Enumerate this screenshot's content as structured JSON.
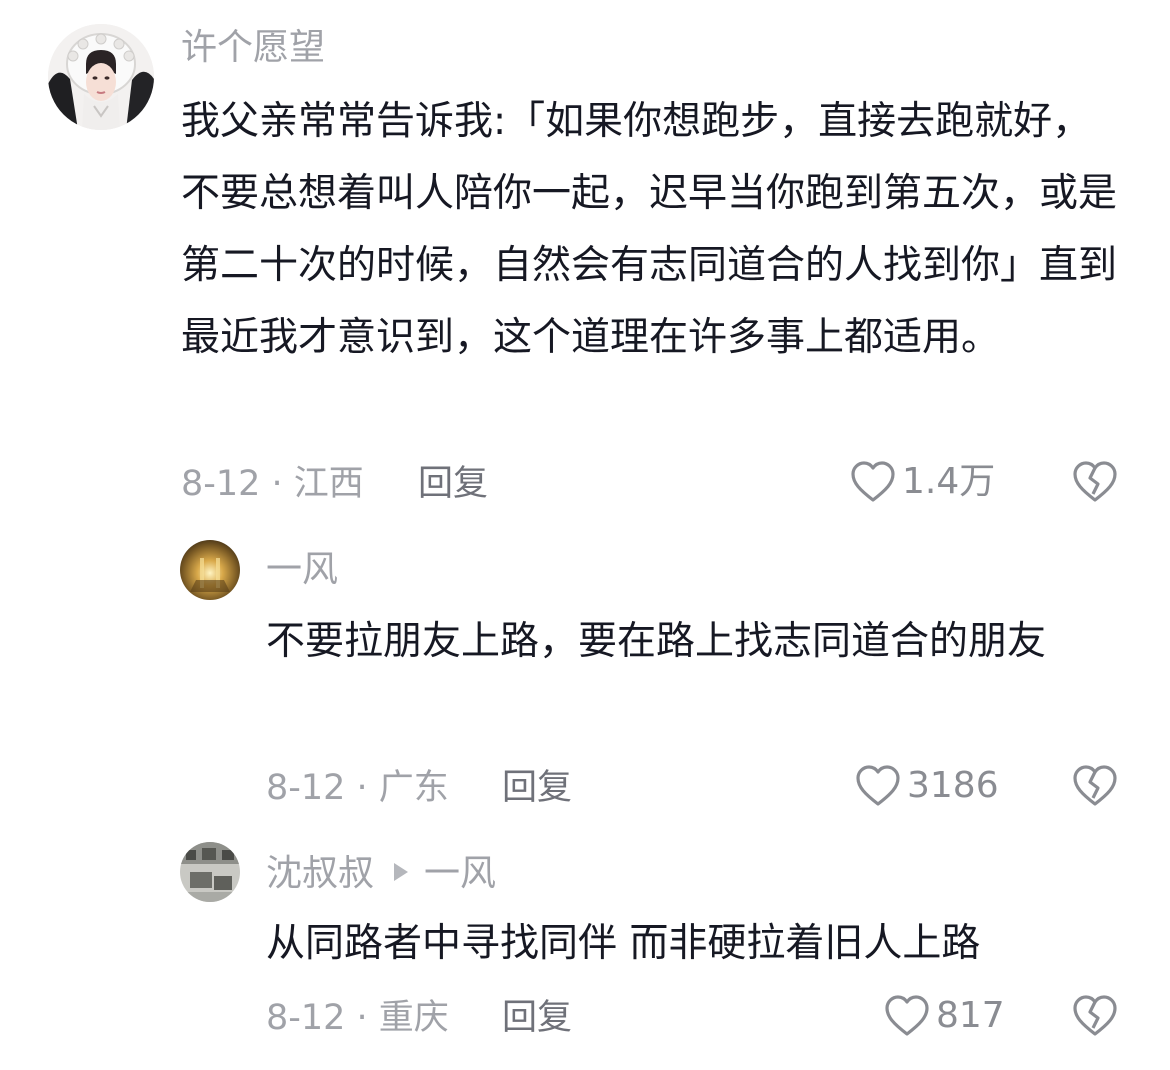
{
  "comments": [
    {
      "username": "许个愿望",
      "text": "我父亲常常告诉我:「如果你想跑步，直接去跑就好，不要总想着叫人陪你一起，迟早当你跑到第五次，或是第二十次的时候，自然会有志同道合的人找到你」直到最近我才意识到，这个道理在许多事上都适用。",
      "date_location": "8-12 · 江西",
      "reply_label": "回复",
      "like_count": "1.4万"
    },
    {
      "username": "一风",
      "text": "不要拉朋友上路，要在路上找志同道合的朋友",
      "date_location": "8-12 · 广东",
      "reply_label": "回复",
      "like_count": "3186"
    },
    {
      "username": "沈叔叔",
      "reply_to": "一风",
      "text": "从同路者中寻找同伴 而非硬拉着旧人上路",
      "date_location": "8-12 · 重庆",
      "reply_label": "回复",
      "like_count": "817"
    }
  ]
}
